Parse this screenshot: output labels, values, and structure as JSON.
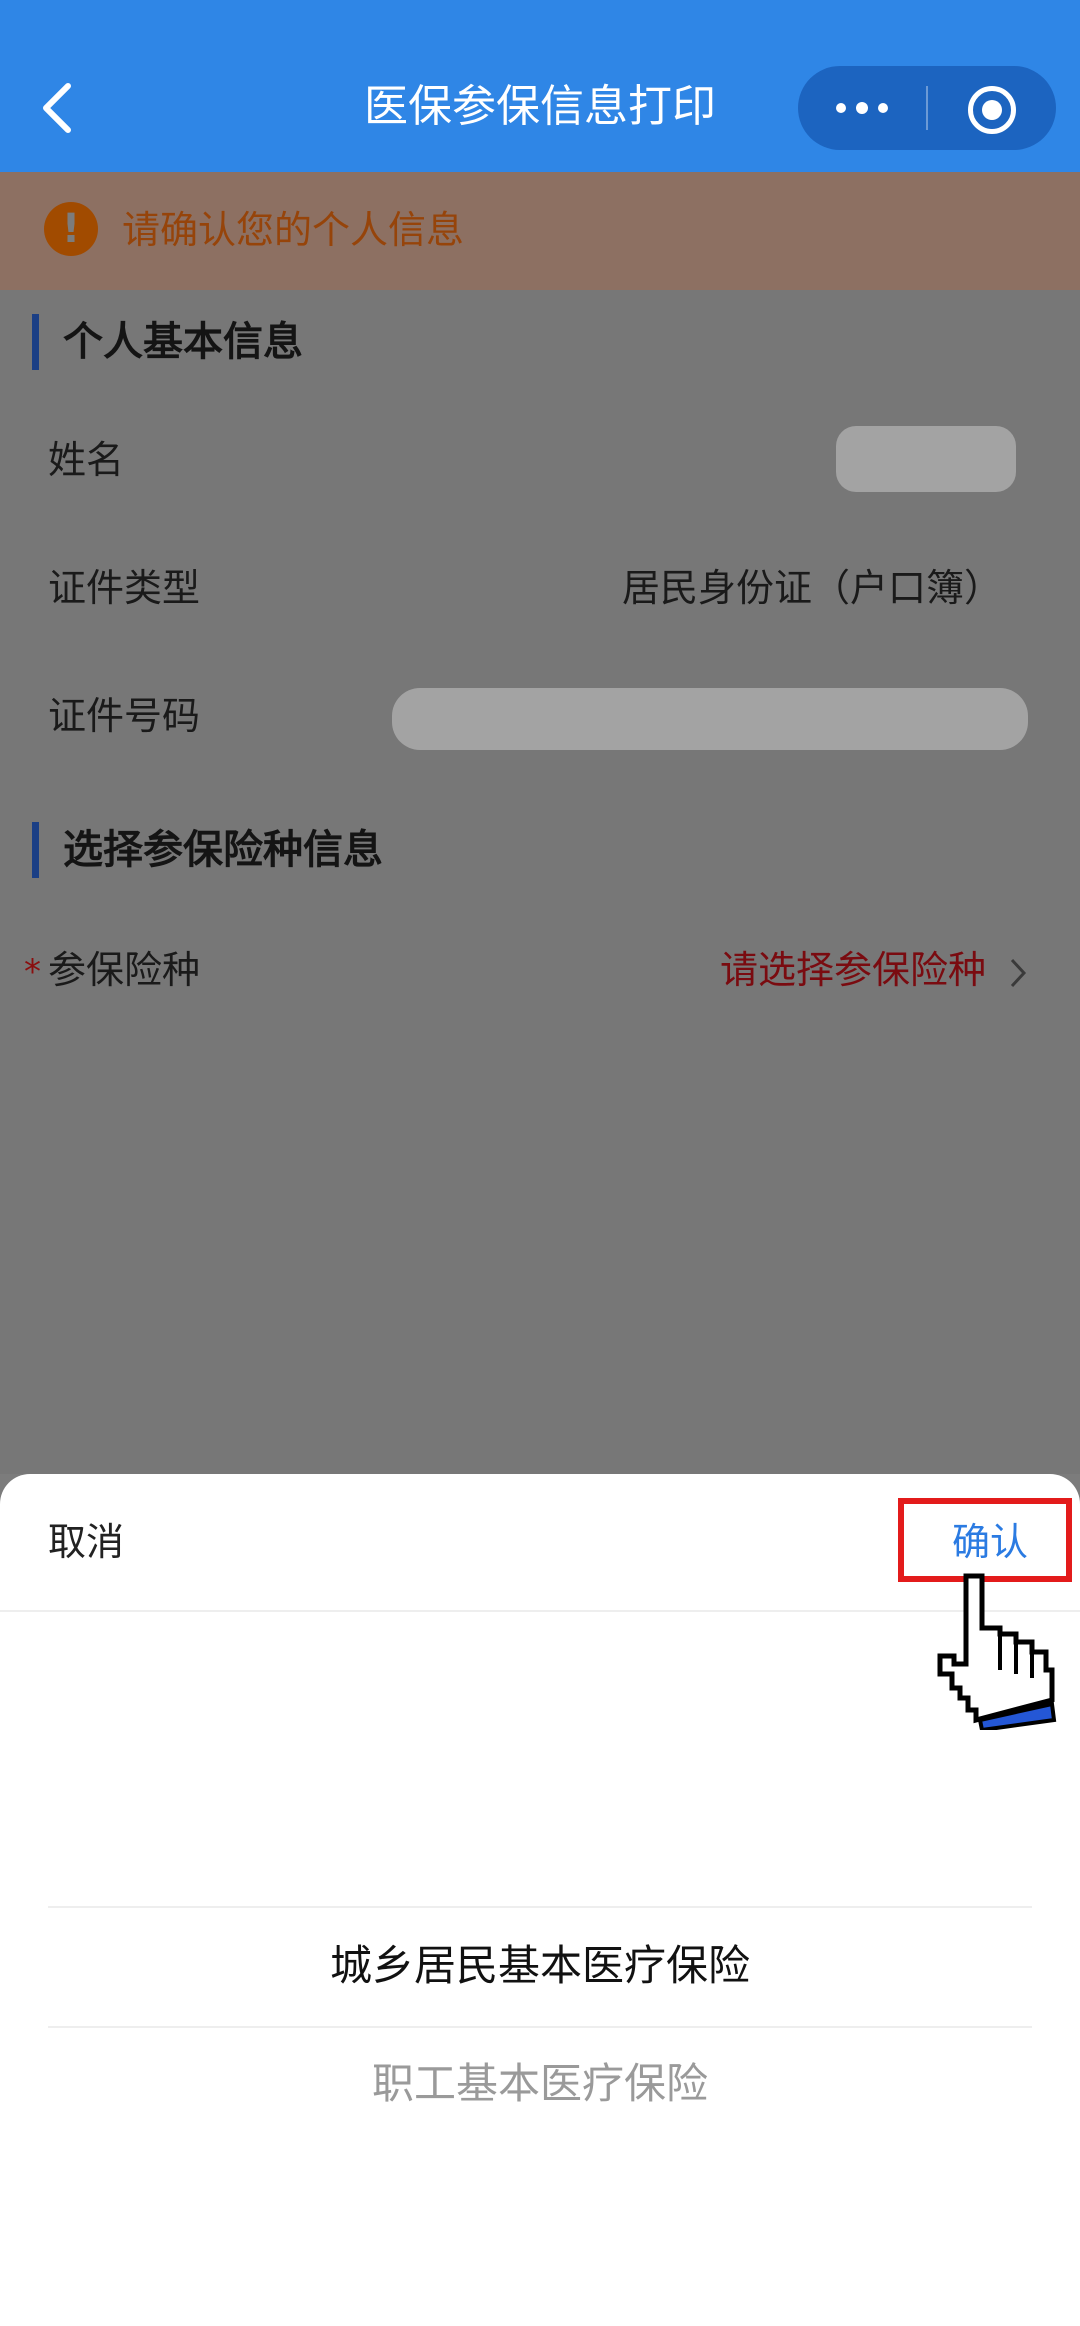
{
  "header": {
    "title": "医保参保信息打印"
  },
  "notice": {
    "icon": "exclamation-icon",
    "text": "请确认您的个人信息"
  },
  "personal_info": {
    "section_title": "个人基本信息",
    "rows": [
      {
        "label": "姓名",
        "value": ""
      },
      {
        "label": "证件类型",
        "value": "居民身份证（户口簿）"
      },
      {
        "label": "证件号码",
        "value": ""
      }
    ]
  },
  "insurance": {
    "section_title": "选择参保险种信息",
    "required_mark": "*",
    "label": "参保险种",
    "placeholder": "请选择参保险种"
  },
  "picker": {
    "cancel_label": "取消",
    "confirm_label": "确认",
    "options": [
      "城乡居民基本医疗保险",
      "职工基本医疗保险"
    ],
    "selected_index": 0
  },
  "colors": {
    "header_bg": "#2f86e6",
    "highlight_border": "#e31b1b",
    "confirm_text": "#2b7be2"
  }
}
